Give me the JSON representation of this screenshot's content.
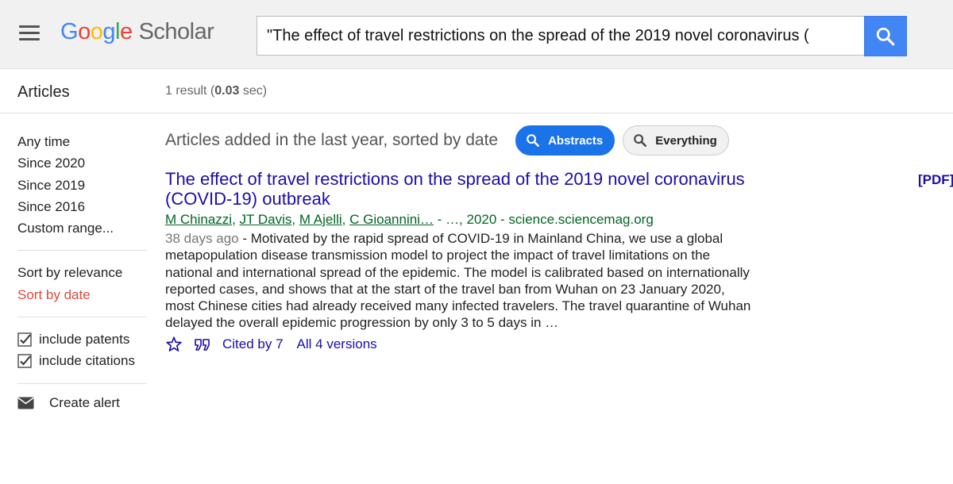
{
  "header": {
    "logo_google": [
      "G",
      "o",
      "o",
      "g",
      "l",
      "e"
    ],
    "logo_scholar": "Scholar",
    "search_value": "\"The effect of travel restrictions on the spread of the 2019 novel coronavirus (",
    "search_icon": "search-icon",
    "menu_icon": "hamburger-menu-icon"
  },
  "subheader": {
    "section_label": "Articles",
    "result_count_prefix": "1 result (",
    "result_time": "0.03",
    "result_count_suffix": " sec)"
  },
  "sidebar": {
    "time_filters": [
      "Any time",
      "Since 2020",
      "Since 2019",
      "Since 2016",
      "Custom range..."
    ],
    "sort_options": [
      "Sort by relevance",
      "Sort by date"
    ],
    "active_sort": "Sort by date",
    "checkboxes": [
      {
        "label": "include patents",
        "checked": true
      },
      {
        "label": "include citations",
        "checked": true
      }
    ],
    "create_alert": "Create alert"
  },
  "main": {
    "filter_text": "Articles added in the last year, sorted by date",
    "pill_abstracts": "Abstracts",
    "pill_everything": "Everything",
    "result": {
      "title": "The effect of travel restrictions on the spread of the 2019 novel coronavirus (COVID-19) outbreak",
      "pdf_label": "[PDF]",
      "authors": [
        "M Chinazzi",
        "JT Davis",
        "M Ajelli",
        "C Gioannini…"
      ],
      "source": " - …, 2020 - science.sciencemag.org",
      "age": "38 days ago",
      "snippet": " - Motivated by the rapid spread of COVID-19 in Mainland China, we use a global metapopulation disease transmission model to project the impact of travel limitations on the national and international spread of the epidemic. The model is calibrated based on internationally reported cases, and shows that at the start of the travel ban from Wuhan on 23 January 2020, most Chinese cities had already received many infected travelers. The travel quarantine of Wuhan delayed the overall epidemic progression by only 3 to 5 days in …",
      "cited_by": "Cited by 7",
      "versions": "All 4 versions"
    }
  },
  "colors": {
    "link": "#1a0dab",
    "author_green": "#006621",
    "active_red": "#dd4b39",
    "accent_blue": "#1a73e8",
    "search_blue": "#4285f4"
  }
}
